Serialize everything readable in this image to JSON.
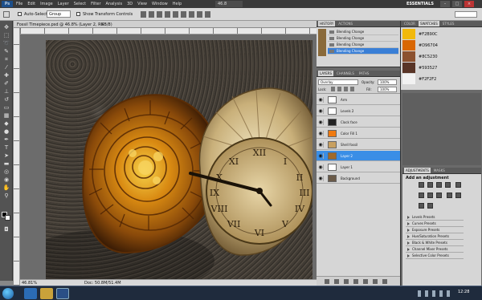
{
  "menubar": {
    "logo": "Ps",
    "items": [
      "File",
      "Edit",
      "Image",
      "Layer",
      "Select",
      "Filter",
      "Analysis",
      "3D",
      "View",
      "Window",
      "Help"
    ],
    "zoom": "46.8",
    "workspace": "ESSENTIALS",
    "win_min": "–",
    "win_max": "□",
    "win_close": "×"
  },
  "options": {
    "auto_select_label": "Auto-Select:",
    "auto_select_value": "Group",
    "transform_label": "Show Transform Controls"
  },
  "document": {
    "tab_title": "Fossil Timepiece.psd @ 46.8% (Layer 2, RGB/8)",
    "tab_close": "×",
    "zoom": "46.81%",
    "doc_info": "Doc: 50.8M/51.4M"
  },
  "history": {
    "tabs": [
      "HISTORY",
      "ACTIONS"
    ],
    "rows": [
      "Blending Change",
      "Blending Change",
      "Blending Change",
      "Blending Change"
    ],
    "selected_index": 3
  },
  "layers": {
    "tabs": [
      "LAYERS",
      "CHANNELS",
      "PATHS"
    ],
    "blend_mode": "Overlay",
    "opacity_label": "Opacity:",
    "opacity": "100%",
    "lock_label": "Lock:",
    "fill_label": "Fill:",
    "fill": "100%",
    "items": [
      {
        "name": "Arm",
        "thumb": "#ffffff"
      },
      {
        "name": "Levels 2",
        "thumb": "#ffffff"
      },
      {
        "name": "Clock face",
        "thumb": "#222222"
      },
      {
        "name": "Color Fill 1",
        "thumb": "#f07a10"
      },
      {
        "name": "Shell fossil",
        "thumb": "#c8a060"
      },
      {
        "name": "Layer 2",
        "thumb": "#a06a2a"
      },
      {
        "name": "Layer 1",
        "thumb": "#ffffff"
      },
      {
        "name": "Background",
        "thumb": "#6a5a48"
      }
    ],
    "selected_index": 5
  },
  "swatches": {
    "tabs": [
      "COLOR",
      "SWATCHES",
      "STYLES"
    ],
    "items": [
      {
        "hex": "#F2B90C",
        "color": "#F2B90C"
      },
      {
        "hex": "#D96704",
        "color": "#D96704"
      },
      {
        "hex": "#8C5230",
        "color": "#8C5230"
      },
      {
        "hex": "#593527",
        "color": "#593527"
      },
      {
        "hex": "#F2F2F2",
        "color": "#F2F2F2"
      }
    ]
  },
  "adjustments": {
    "tabs": [
      "ADJUSTMENTS",
      "MASKS"
    ],
    "heading": "Add an adjustment",
    "presets": [
      "Levels Presets",
      "Curves Presets",
      "Exposure Presets",
      "Hue/Saturation Presets",
      "Black & White Presets",
      "Channel Mixer Presets",
      "Selective Color Presets"
    ]
  },
  "taskbar": {
    "time": "12:28"
  }
}
